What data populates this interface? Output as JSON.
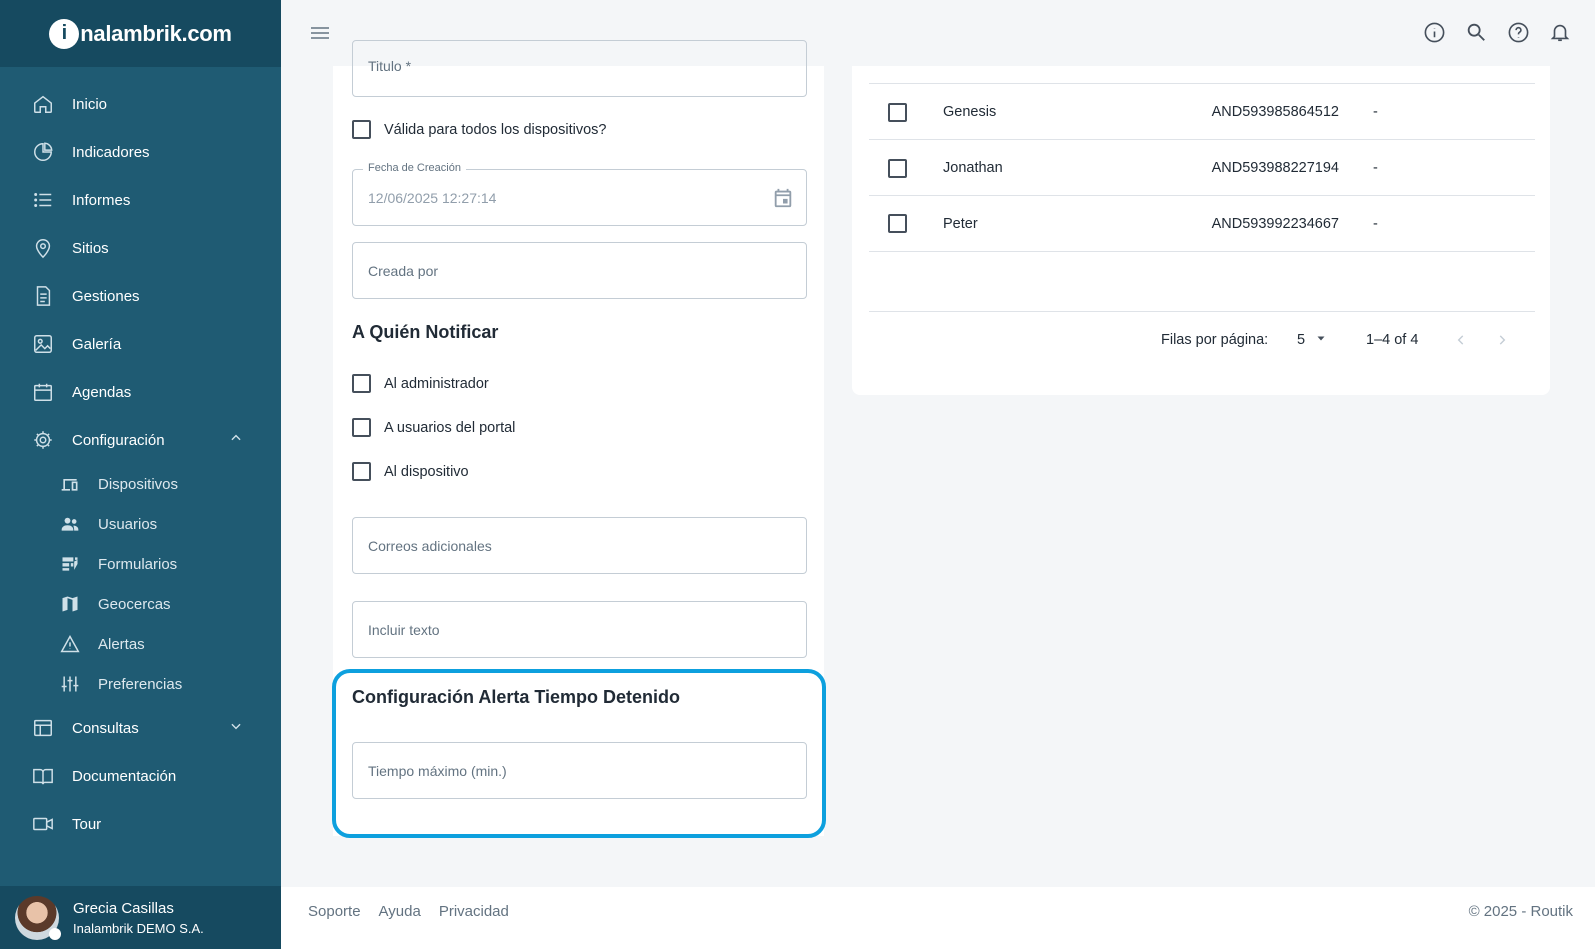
{
  "brand": {
    "badge": "i",
    "name": "nalambrik.com"
  },
  "sidebar": {
    "items": [
      {
        "label": "Inicio",
        "icon": "home-icon"
      },
      {
        "label": "Indicadores",
        "icon": "pie-chart-icon"
      },
      {
        "label": "Informes",
        "icon": "list-icon"
      },
      {
        "label": "Sitios",
        "icon": "location-pin-icon"
      },
      {
        "label": "Gestiones",
        "icon": "document-icon"
      },
      {
        "label": "Galería",
        "icon": "image-icon"
      },
      {
        "label": "Agendas",
        "icon": "calendar-icon"
      },
      {
        "label": "Configuración",
        "icon": "gear-icon",
        "expanded": true
      },
      {
        "label": "Consultas",
        "icon": "table-icon",
        "expanded": false
      },
      {
        "label": "Documentación",
        "icon": "book-icon"
      },
      {
        "label": "Tour",
        "icon": "video-camera-icon"
      }
    ],
    "config_sub": [
      {
        "label": "Dispositivos",
        "icon": "devices-icon"
      },
      {
        "label": "Usuarios",
        "icon": "users-icon"
      },
      {
        "label": "Formularios",
        "icon": "form-icon"
      },
      {
        "label": "Geocercas",
        "icon": "map-icon"
      },
      {
        "label": "Alertas",
        "icon": "warning-icon"
      },
      {
        "label": "Preferencias",
        "icon": "sliders-icon"
      }
    ]
  },
  "user": {
    "name": "Grecia Casillas",
    "org": "Inalambrik DEMO S.A."
  },
  "form": {
    "titulo_label": "Titulo *",
    "valida_label": "Válida para todos los dispositivos?",
    "fecha_legend": "Fecha de Creación",
    "fecha_value": "12/06/2025 12:27:14",
    "creada_placeholder": "Creada por",
    "notificar_title": "A Quién Notificar",
    "notificar_options": [
      "Al administrador",
      "A usuarios del portal",
      "Al dispositivo"
    ],
    "correos_placeholder": "Correos adicionales",
    "incluir_placeholder": "Incluir texto",
    "config_title": "Configuración Alerta Tiempo Detenido",
    "tiempo_placeholder": "Tiempo máximo (min.)"
  },
  "devices_table": {
    "rows": [
      {
        "name": "Genesis",
        "id": "AND593985864512",
        "extra": "-"
      },
      {
        "name": "Jonathan",
        "id": "AND593988227194",
        "extra": "-"
      },
      {
        "name": "Peter",
        "id": "AND593992234667",
        "extra": "-"
      }
    ],
    "rows_per_page_label": "Filas por página:",
    "rows_per_page": "5",
    "range": "1–4 of 4"
  },
  "footer": {
    "links": [
      "Soporte",
      "Ayuda",
      "Privacidad"
    ],
    "copyright": "© 2025 - Routik"
  },
  "colors": {
    "sidebar": "#1f5b73",
    "sidebar_dark": "#164a60",
    "highlight": "#0da0de"
  }
}
